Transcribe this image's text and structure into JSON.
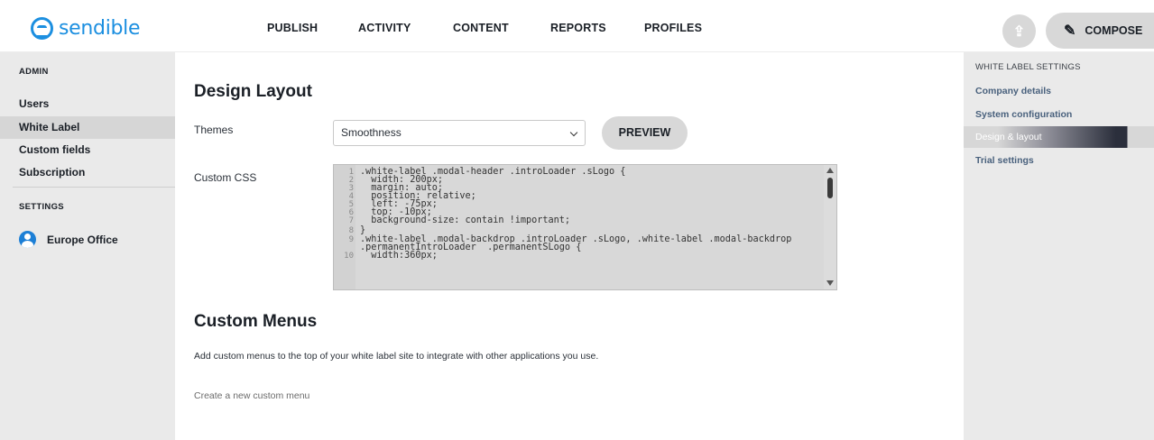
{
  "brand": {
    "name": "sendible"
  },
  "nav": [
    "PUBLISH",
    "ACTIVITY",
    "CONTENT",
    "REPORTS",
    "PROFILES"
  ],
  "header": {
    "upload_icon": "upload-icon",
    "upload_glyph": "⇪",
    "compose_label": "COMPOSE",
    "compose_icon": "pencil-icon",
    "compose_glyph": "✎"
  },
  "left_sidebar": {
    "admin_heading": "ADMIN",
    "items": [
      "Users",
      "White Label",
      "Custom fields",
      "Subscription"
    ],
    "active_item": "White Label",
    "settings_heading": "SETTINGS",
    "account": "Europe Office"
  },
  "main": {
    "design_title": "Design Layout",
    "themes_label": "Themes",
    "theme_value": "Smoothness",
    "preview_label": "PREVIEW",
    "css_label": "Custom CSS",
    "css_lines": [
      {
        "n": "1",
        "text": ".white-label .modal-header .introLoader .sLogo {"
      },
      {
        "n": "2",
        "text": "  width: 200px;"
      },
      {
        "n": "3",
        "text": "  margin: auto;"
      },
      {
        "n": "4",
        "text": "  position: relative;"
      },
      {
        "n": "5",
        "text": "  left: -75px;"
      },
      {
        "n": "6",
        "text": "  top: -10px;"
      },
      {
        "n": "7",
        "text": "  background-size: contain !important;"
      },
      {
        "n": "8",
        "text": "}"
      },
      {
        "n": "9",
        "text": ".white-label .modal-backdrop .introLoader .sLogo, .white-label .modal-backdrop"
      },
      {
        "n": "",
        "text": ".permanentIntroLoader  .permanentSLogo {"
      },
      {
        "n": "10",
        "text": "  width:360px;"
      }
    ],
    "menus_title": "Custom Menus",
    "menus_description": "Add custom menus to the top of your white label site to integrate with other applications you use.",
    "create_menu_link": "Create a new custom menu"
  },
  "right_sidebar": {
    "heading": "WHITE LABEL SETTINGS",
    "items": [
      "Company details",
      "System configuration",
      "Design & layout",
      "Trial settings"
    ],
    "active_item": "Design & layout"
  },
  "colors": {
    "brand": "#1c8fe0",
    "sidebar_bg": "#eaeaea",
    "button_bg": "#d8d8d8",
    "link": "#49617d"
  }
}
